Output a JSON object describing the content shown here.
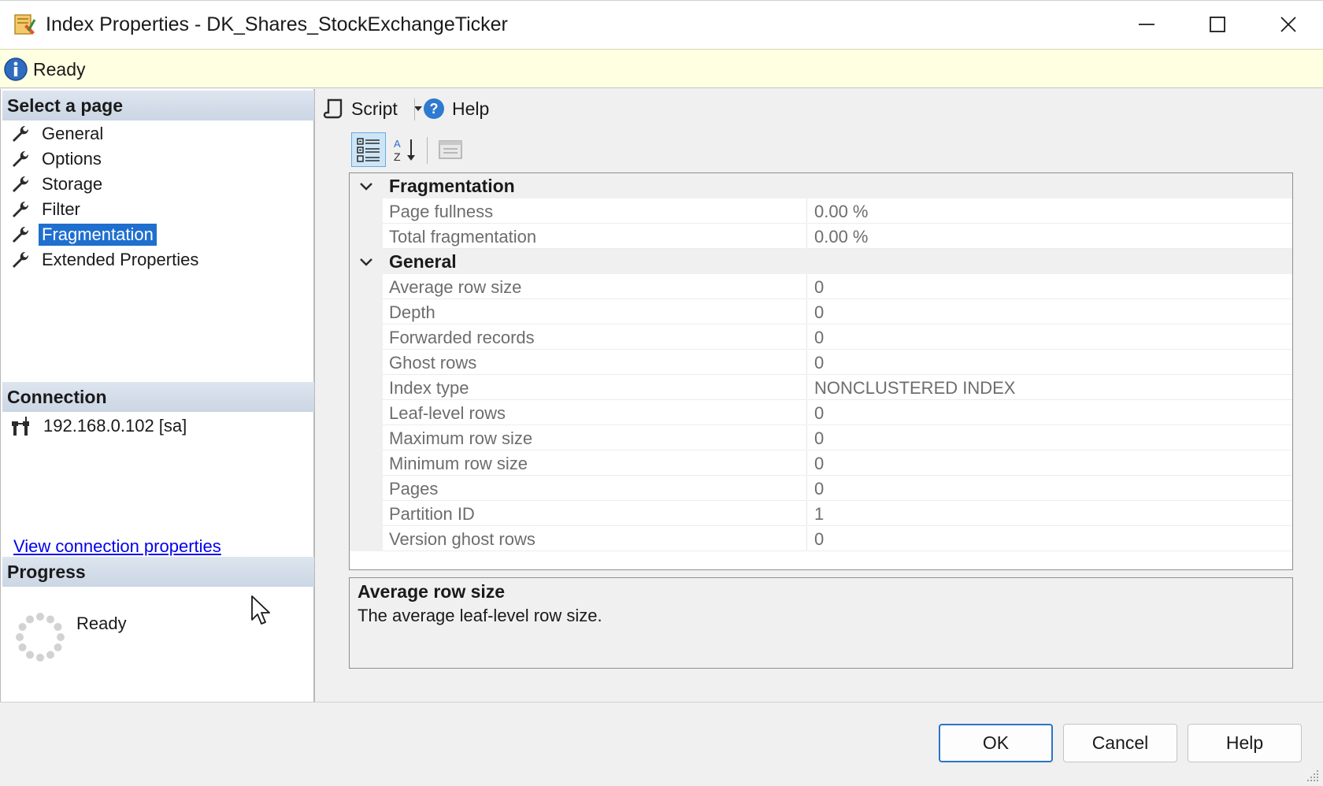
{
  "window": {
    "title": "Index Properties - DK_Shares_StockExchangeTicker"
  },
  "status": {
    "text": "Ready"
  },
  "left": {
    "select_page_header": "Select a page",
    "pages": [
      {
        "label": "General",
        "selected": false
      },
      {
        "label": "Options",
        "selected": false
      },
      {
        "label": "Storage",
        "selected": false
      },
      {
        "label": "Filter",
        "selected": false
      },
      {
        "label": "Fragmentation",
        "selected": true
      },
      {
        "label": "Extended Properties",
        "selected": false
      }
    ],
    "connection_header": "Connection",
    "connection": "192.168.0.102 [sa]",
    "view_connection_link": "View connection properties",
    "progress_header": "Progress",
    "progress_status": "Ready"
  },
  "toolbar": {
    "script_label": "Script",
    "help_label": "Help"
  },
  "grid": {
    "categories": [
      {
        "name": "Fragmentation",
        "properties": [
          {
            "name": "Page fullness",
            "value": "0.00 %"
          },
          {
            "name": "Total fragmentation",
            "value": "0.00 %"
          }
        ]
      },
      {
        "name": "General",
        "properties": [
          {
            "name": "Average row size",
            "value": "0"
          },
          {
            "name": "Depth",
            "value": "0"
          },
          {
            "name": "Forwarded records",
            "value": "0"
          },
          {
            "name": "Ghost rows",
            "value": "0"
          },
          {
            "name": "Index type",
            "value": "NONCLUSTERED INDEX"
          },
          {
            "name": "Leaf-level rows",
            "value": "0"
          },
          {
            "name": "Maximum row size",
            "value": "0"
          },
          {
            "name": "Minimum row size",
            "value": "0"
          },
          {
            "name": "Pages",
            "value": "0"
          },
          {
            "name": "Partition ID",
            "value": "1"
          },
          {
            "name": "Version ghost rows",
            "value": "0"
          }
        ]
      }
    ]
  },
  "description": {
    "title": "Average row size",
    "text": "The average leaf-level row size."
  },
  "buttons": {
    "ok": "OK",
    "cancel": "Cancel",
    "help": "Help"
  },
  "colors": {
    "selection": "#1f6fcf",
    "status_bg": "#ffffe1",
    "link": "#0000ee",
    "default_button_border": "#2a74c9"
  }
}
